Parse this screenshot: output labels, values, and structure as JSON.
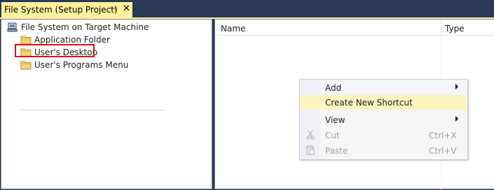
{
  "tab": {
    "title": "File System (Setup Project)",
    "pin_glyph": "⊣",
    "close_glyph": "✕"
  },
  "tree": {
    "root": {
      "label": "File System on Target Machine",
      "icon": "computer-icon"
    },
    "items": [
      {
        "label": "Application Folder",
        "icon": "folder-icon"
      },
      {
        "label": "User's Desktop",
        "icon": "folder-icon",
        "highlighted": true
      },
      {
        "label": "User's Programs Menu",
        "icon": "folder-icon"
      }
    ]
  },
  "list": {
    "columns": [
      "Name",
      "Type"
    ]
  },
  "context_menu": {
    "items": [
      {
        "label": "Add",
        "submenu": true
      },
      {
        "label": "Create New Shortcut",
        "hover": true
      },
      {
        "label": "View",
        "submenu": true
      },
      {
        "label": "Cut",
        "shortcut": "Ctrl+X",
        "disabled": true,
        "icon": "cut-icon"
      },
      {
        "label": "Paste",
        "shortcut": "Ctrl+V",
        "disabled": true,
        "icon": "paste-icon"
      }
    ]
  },
  "colors": {
    "frame": "#293955",
    "active_tab": "#fff29d",
    "highlight_border": "#e01010",
    "menu_hover": "#fdf4bf"
  }
}
